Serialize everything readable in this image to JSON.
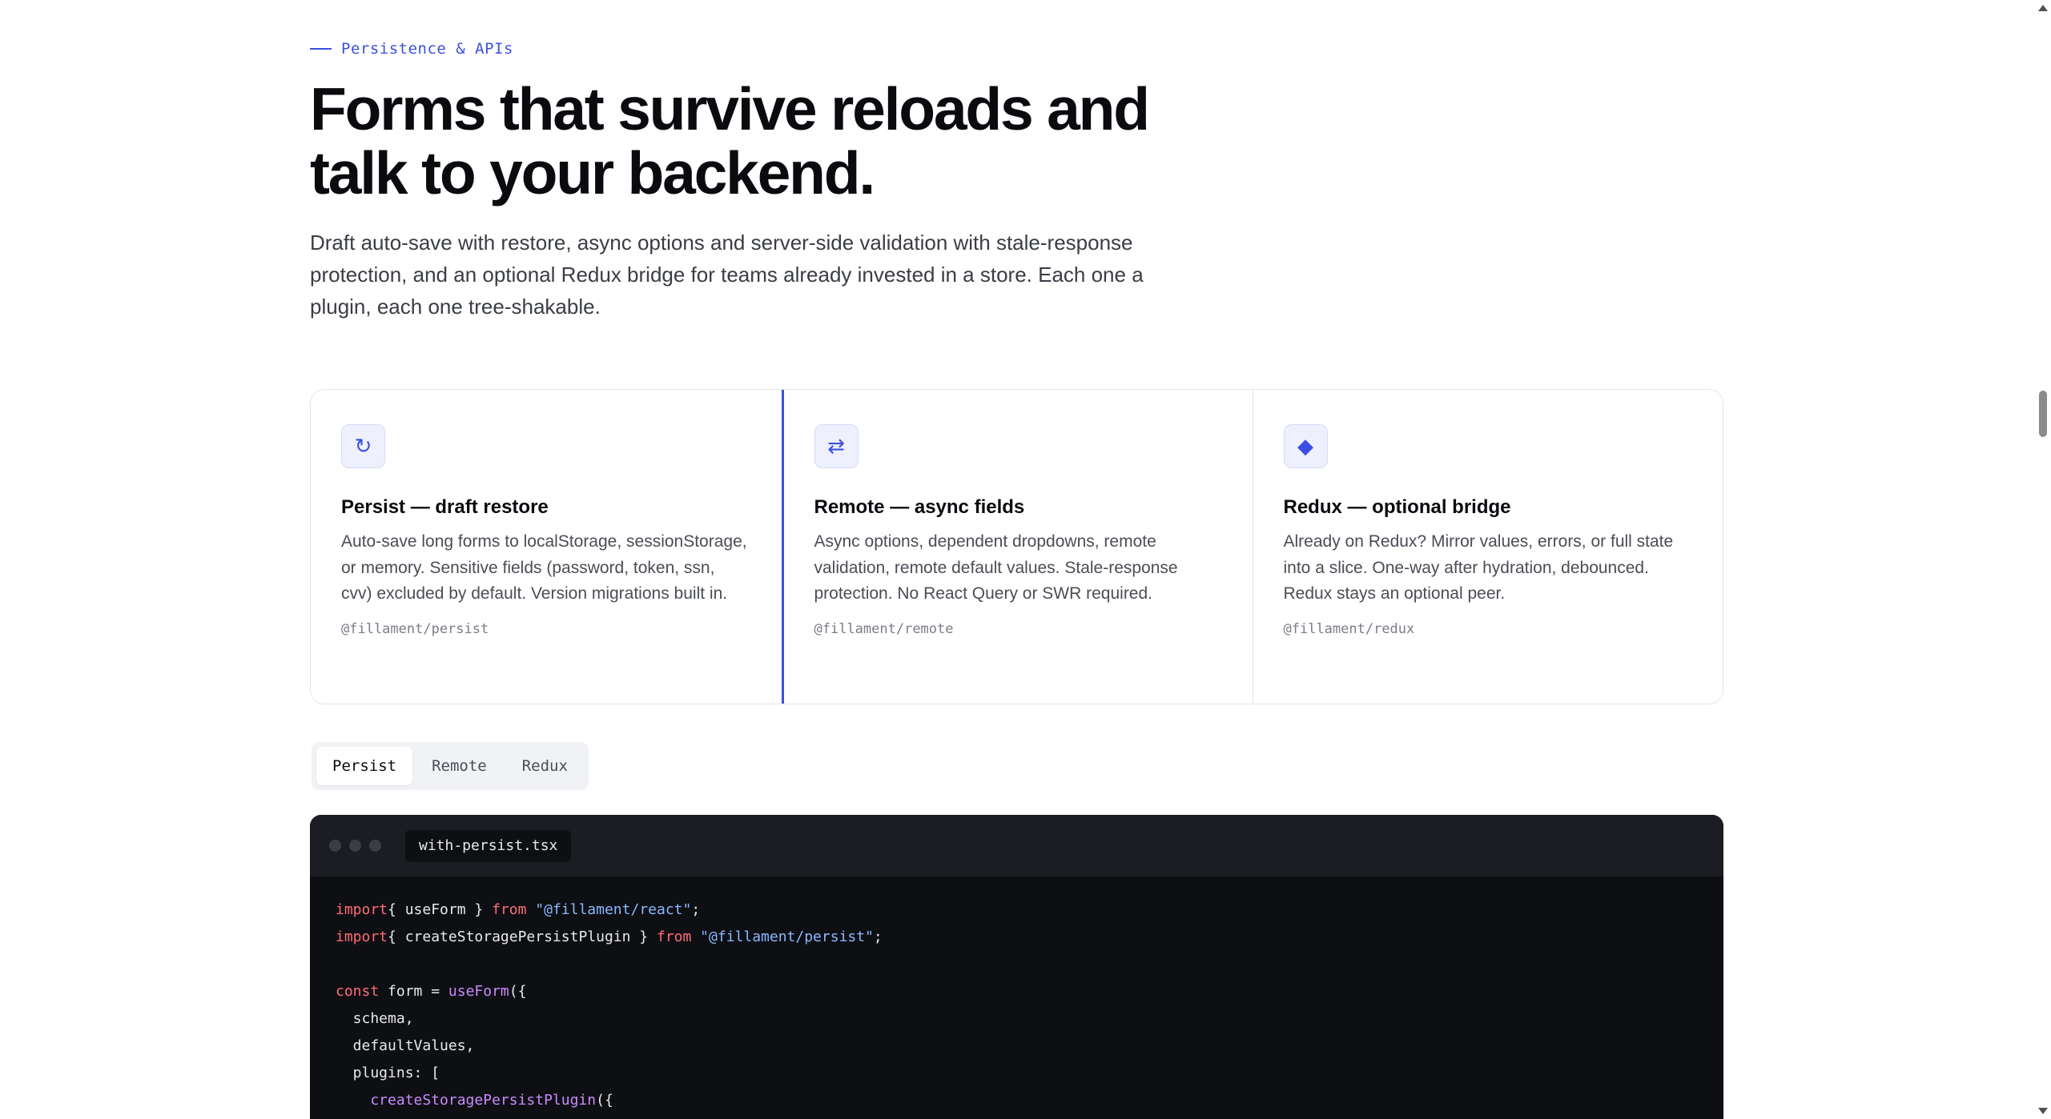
{
  "section": {
    "eyebrow": "Persistence & APIs",
    "headline_line1": "Forms that survive reloads and",
    "headline_line2": "talk to your backend.",
    "lede": "Draft auto-save with restore, async options and server-side validation with stale-response protection, and an optional Redux bridge for teams already invested in a store. Each one a plugin, each one tree-shakable."
  },
  "cards": [
    {
      "icon": "refresh-icon",
      "icon_glyph": "↻",
      "title": "Persist — draft restore",
      "description": "Auto-save long forms to localStorage, sessionStorage, or memory. Sensitive fields (password, token, ssn, cvv) excluded by default. Version migrations built in.",
      "package": "@fillament/persist"
    },
    {
      "icon": "swap-arrows-icon",
      "icon_glyph": "⇄",
      "title": "Remote — async fields",
      "description": "Async options, dependent dropdowns, remote validation, remote default values. Stale-response protection. No React Query or SWR required.",
      "package": "@fillament/remote"
    },
    {
      "icon": "diamond-icon",
      "icon_glyph": "◆",
      "title": "Redux — optional bridge",
      "description": "Already on Redux? Mirror values, errors, or full state into a slice. One-way after hydration, debounced. Redux stays an optional peer.",
      "package": "@fillament/redux"
    }
  ],
  "tabs": [
    {
      "label": "Persist",
      "selected": true
    },
    {
      "label": "Remote",
      "selected": false
    },
    {
      "label": "Redux",
      "selected": false
    }
  ],
  "code": {
    "filename": "with-persist.tsx",
    "lines": [
      [
        [
          "kw",
          "import"
        ],
        [
          "",
          "{ useForm } "
        ],
        [
          "kw",
          "from"
        ],
        [
          "",
          ""
        ],
        [
          "str",
          " \"@fillament/react\""
        ],
        [
          "",
          ";"
        ]
      ],
      [
        [
          "kw",
          "import"
        ],
        [
          "",
          "{ createStoragePersistPlugin } "
        ],
        [
          "kw",
          "from"
        ],
        [
          "str",
          " \"@fillament/persist\""
        ],
        [
          "",
          ";"
        ]
      ],
      [],
      [
        [
          "kw",
          "const"
        ],
        [
          "",
          " form = "
        ],
        [
          "fn",
          "useForm"
        ],
        [
          "",
          "({"
        ]
      ],
      [
        [
          "",
          "  schema,"
        ]
      ],
      [
        [
          "",
          "  defaultValues,"
        ]
      ],
      [
        [
          "",
          "  plugins: ["
        ]
      ],
      [
        [
          "fn",
          "    createStoragePersistPlugin"
        ],
        [
          "",
          "({"
        ]
      ]
    ]
  },
  "colors": {
    "accent": "#3b50e0",
    "code_bg": "#0e0f13",
    "keyword": "#ff6b7a",
    "string": "#8ab8ff",
    "function": "#c98bff"
  }
}
